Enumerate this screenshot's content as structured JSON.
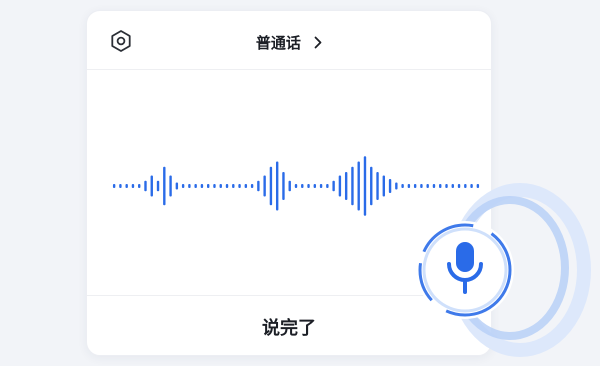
{
  "header": {
    "language_label": "普通话",
    "chevron": "chevron-right-icon",
    "settings_icon": "hexagon-settings-icon"
  },
  "footer": {
    "done_label": "说完了"
  },
  "mic": {
    "icon": "microphone-icon",
    "accent": "#2a6be8",
    "ring_color": "#a9c6f6"
  },
  "waveform": {
    "color": "#2a6be8",
    "levels": [
      0.04,
      0.04,
      0.04,
      0.04,
      0.04,
      0.15,
      0.3,
      0.15,
      0.55,
      0.3,
      0.1,
      0.04,
      0.04,
      0.04,
      0.04,
      0.04,
      0.04,
      0.04,
      0.04,
      0.04,
      0.04,
      0.04,
      0.04,
      0.15,
      0.3,
      0.55,
      0.7,
      0.4,
      0.15,
      0.04,
      0.04,
      0.04,
      0.04,
      0.04,
      0.04,
      0.15,
      0.3,
      0.4,
      0.55,
      0.7,
      0.85,
      0.55,
      0.4,
      0.3,
      0.2,
      0.1,
      0.04,
      0.04,
      0.04,
      0.04,
      0.04,
      0.04,
      0.04,
      0.04,
      0.04,
      0.04,
      0.04,
      0.04,
      0.04
    ]
  }
}
